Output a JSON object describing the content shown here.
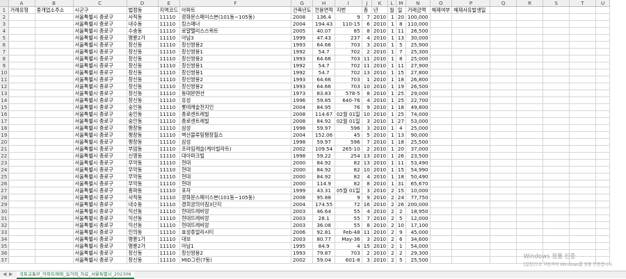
{
  "columns": [
    "A",
    "B",
    "C",
    "D",
    "E",
    "F",
    "G",
    "H",
    "I",
    "J",
    "K",
    "L",
    "M",
    "N",
    "O",
    "P",
    "Q",
    "R",
    "S",
    "T",
    "U"
  ],
  "header_row": {
    "row": "1",
    "cells": [
      "거래유형",
      "중개업소주소",
      "시군구",
      "법정동",
      "지역코드",
      "아파트",
      "건축년도",
      "전용면적",
      "지번",
      "층",
      "년",
      "월",
      "일",
      "거래금액",
      "해제여부",
      "해제사유발생일",
      "",
      "",
      "",
      "",
      ""
    ]
  },
  "rows": [
    [
      "2",
      "",
      "",
      "서울특별시 종로구",
      "사직동",
      "11110",
      "광화문스페이스본(101동~105동)",
      "2008",
      "136.4",
      "9",
      "7",
      "2010",
      "1",
      "20",
      "100,000"
    ],
    [
      "3",
      "",
      "",
      "서울특별시 종로구",
      "내수동",
      "11110",
      "킹스매너",
      "2004",
      "194.43",
      "110-15",
      "6",
      "2010",
      "1",
      "8",
      "110,000"
    ],
    [
      "4",
      "",
      "",
      "서울특별시 종로구",
      "수송동",
      "11110",
      "로얄팰리스스위트",
      "2005",
      "40.07",
      "85",
      "8",
      "2010",
      "1",
      "11",
      "26,500"
    ],
    [
      "5",
      "",
      "",
      "서울특별시 종로구",
      "명륜2가",
      "11110",
      "아남3",
      "1999",
      "47.43",
      "237",
      "4",
      "2010",
      "1",
      "13",
      "30,000"
    ],
    [
      "6",
      "",
      "",
      "서울특별시 종로구",
      "창신동",
      "11110",
      "창신쌍용2",
      "1993",
      "64.66",
      "703",
      "3",
      "2010",
      "1",
      "5",
      "25,900"
    ],
    [
      "7",
      "",
      "",
      "서울특별시 종로구",
      "창신동",
      "11110",
      "창신쌍용1",
      "1992",
      "54.7",
      "702",
      "2",
      "2010",
      "1",
      "7",
      "25,300"
    ],
    [
      "8",
      "",
      "",
      "서울특별시 종로구",
      "창신동",
      "11110",
      "창신쌍용2",
      "1993",
      "64.66",
      "703",
      "11",
      "2010",
      "1",
      "8",
      "25,000"
    ],
    [
      "9",
      "",
      "",
      "서울특별시 종로구",
      "창신동",
      "11110",
      "창신쌍용1",
      "1992",
      "54.7",
      "702",
      "11",
      "2010",
      "1",
      "11",
      "27,900"
    ],
    [
      "10",
      "",
      "",
      "서울특별시 종로구",
      "창신동",
      "11110",
      "창신쌍용1",
      "1992",
      "54.7",
      "702",
      "13",
      "2010",
      "1",
      "15",
      "27,800"
    ],
    [
      "11",
      "",
      "",
      "서울특별시 종로구",
      "창신동",
      "11110",
      "창신쌍용2",
      "1993",
      "64.66",
      "703",
      "1",
      "2010",
      "1",
      "18",
      "26,800"
    ],
    [
      "12",
      "",
      "",
      "서울특별시 종로구",
      "창신동",
      "11110",
      "창신쌍용2",
      "1993",
      "64.66",
      "703",
      "10",
      "2010",
      "1",
      "19",
      "26,500"
    ],
    [
      "13",
      "",
      "",
      "서울특별시 종로구",
      "창신동",
      "11110",
      "동대문맨션",
      "1973",
      "83.83",
      "578-5",
      "8",
      "2010",
      "1",
      "25",
      "29,000"
    ],
    [
      "14",
      "",
      "",
      "서울특별시 종로구",
      "창신동",
      "11110",
      "유성",
      "1996",
      "59.85",
      "640-76",
      "4",
      "2010",
      "1",
      "25",
      "22,700"
    ],
    [
      "15",
      "",
      "",
      "서울특별시 종로구",
      "숭인동",
      "11110",
      "롯데캐슬천지인",
      "2004",
      "84.95",
      "76",
      "9",
      "2010",
      "1",
      "18",
      "49,800"
    ],
    [
      "16",
      "",
      "",
      "서울특별시 종로구",
      "숭인동",
      "11110",
      "종로센트레빌",
      "2008",
      "114.67",
      "02월 01일",
      "10",
      "2010",
      "1",
      "25",
      "74,000"
    ],
    [
      "17",
      "",
      "",
      "서울특별시 종로구",
      "숭인동",
      "11110",
      "종로센트레빌",
      "2008",
      "84.92",
      "02월 01일",
      "3",
      "2010",
      "1",
      "27",
      "53,000"
    ],
    [
      "18",
      "",
      "",
      "서울특별시 종로구",
      "평창동",
      "11110",
      "삼성",
      "1998",
      "59.97",
      "596",
      "3",
      "2010",
      "1",
      "4",
      "25,000"
    ],
    [
      "19",
      "",
      "",
      "서울특별시 종로구",
      "평창동",
      "11110",
      "벽산블루밍평창힐스",
      "2004",
      "152.06",
      "45",
      "5",
      "2010",
      "1",
      "13",
      "90,000"
    ],
    [
      "20",
      "",
      "",
      "서울특별시 종로구",
      "평창동",
      "11110",
      "삼성",
      "1998",
      "59.97",
      "596",
      "7",
      "2010",
      "1",
      "18",
      "25,500"
    ],
    [
      "21",
      "",
      "",
      "서울특별시 종로구",
      "부암동",
      "11110",
      "프라임캐슬(케이빌라트)",
      "2002",
      "109.54",
      "265-10",
      "2",
      "2010",
      "1",
      "20",
      "37,000"
    ],
    [
      "22",
      "",
      "",
      "서울특별시 종로구",
      "신영동",
      "11110",
      "대아파크빌",
      "1998",
      "59.22",
      "254",
      "13",
      "2010",
      "1",
      "26",
      "23,500"
    ],
    [
      "23",
      "",
      "",
      "서울특별시 종로구",
      "무악동",
      "11110",
      "현대",
      "2000",
      "84.92",
      "82",
      "13",
      "2010",
      "1",
      "11",
      "53,490"
    ],
    [
      "24",
      "",
      "",
      "서울특별시 종로구",
      "무악동",
      "11110",
      "현대",
      "2000",
      "84.92",
      "82",
      "10",
      "2010",
      "1",
      "15",
      "54,990"
    ],
    [
      "25",
      "",
      "",
      "서울특별시 종로구",
      "무악동",
      "11110",
      "현대",
      "2000",
      "84.92",
      "82",
      "4",
      "2010",
      "1",
      "18",
      "50,490"
    ],
    [
      "26",
      "",
      "",
      "서울특별시 종로구",
      "무악동",
      "11110",
      "현대",
      "2000",
      "114.9",
      "82",
      "8",
      "2010",
      "1",
      "31",
      "65,670"
    ],
    [
      "27",
      "",
      "",
      "서울특별시 종로구",
      "홍파동",
      "11110",
      "포자",
      "1999",
      "43.31",
      "05월 01일",
      "3",
      "2010",
      "2",
      "15",
      "10,000"
    ],
    [
      "28",
      "",
      "",
      "서울특별시 종로구",
      "사직동",
      "11110",
      "광화문스페이스본(101동~105동)",
      "2008",
      "95.88",
      "9",
      "9",
      "2010",
      "2",
      "24",
      "77,750"
    ],
    [
      "29",
      "",
      "",
      "서울특별시 종로구",
      "내수동",
      "11110",
      "경희궁의아침3단지",
      "2004",
      "174.55",
      "72",
      "16",
      "2010",
      "2",
      "26",
      "200,000"
    ],
    [
      "30",
      "",
      "",
      "서울특별시 종로구",
      "익선동",
      "11110",
      "현대뜨레비앙",
      "2003",
      "46.64",
      "55",
      "4",
      "2010",
      "2",
      "2",
      "18,950"
    ],
    [
      "31",
      "",
      "",
      "서울특별시 종로구",
      "익선동",
      "11110",
      "현대뜨레비앙",
      "2003",
      "28.1",
      "55",
      "7",
      "2010",
      "2",
      "5",
      "12,000"
    ],
    [
      "32",
      "",
      "",
      "서울특별시 종로구",
      "익선동",
      "11110",
      "현대뜨레비앙",
      "2003",
      "36.08",
      "55",
      "8",
      "2010",
      "2",
      "10",
      "17,100"
    ],
    [
      "33",
      "",
      "",
      "서울특별시 종로구",
      "인의동",
      "11110",
      "효성쥬얼리시티",
      "2006",
      "92.81",
      "Feb-48",
      "11",
      "2010",
      "2",
      "9",
      "45,000"
    ],
    [
      "34",
      "",
      "",
      "서울특별시 종로구",
      "명륜1가",
      "11110",
      "대보",
      "2003",
      "80.77",
      "May-36",
      "3",
      "2010",
      "2",
      "6",
      "34,600"
    ],
    [
      "35",
      "",
      "",
      "서울특별시 종로구",
      "명륜2가",
      "11110",
      "아남1",
      "1995",
      "84.9",
      "4",
      "15",
      "2010",
      "2",
      "1",
      "54,000"
    ],
    [
      "36",
      "",
      "",
      "서울특별시 종로구",
      "창신동",
      "11110",
      "창신쌍용2",
      "1993",
      "79.87",
      "703",
      "2",
      "2010",
      "2",
      "2",
      "29,300"
    ],
    [
      "37",
      "",
      "",
      "서울특별시 종로구",
      "창신동",
      "11110",
      "MID그린(7동)",
      "2002",
      "59.04",
      "601-8",
      "3",
      "2010",
      "2",
      "5",
      "25,500"
    ]
  ],
  "sheet_tab": "국토교통부_아파트매매_실거래_자료_서울특별시_202306",
  "watermark": {
    "line1": "Windows 정품 인증",
    "line2": "[설정]으로 이동하여 Windows를 정품 인증합니다."
  }
}
